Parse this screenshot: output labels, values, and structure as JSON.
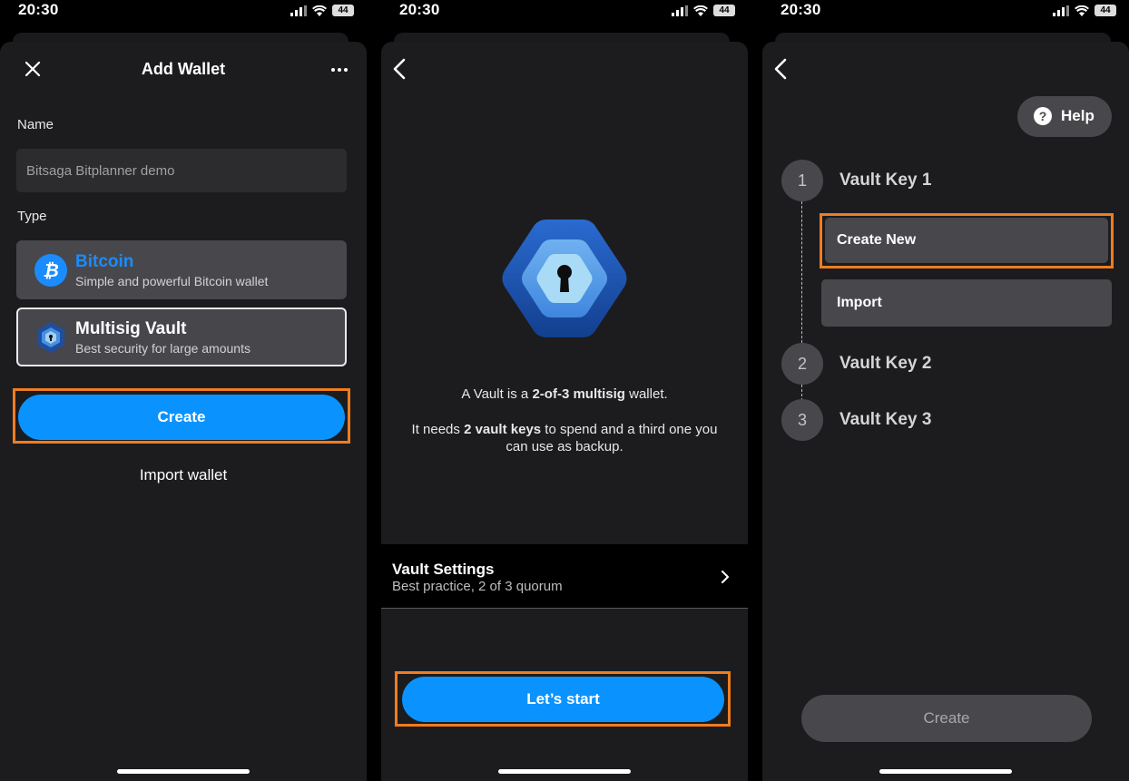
{
  "status": {
    "time": "20:30",
    "battery": "44"
  },
  "screen1": {
    "title": "Add Wallet",
    "name_label": "Name",
    "name_value": "Bitsaga Bitplanner demo",
    "type_label": "Type",
    "bitcoin": {
      "title": "Bitcoin",
      "subtitle": "Simple and powerful Bitcoin wallet"
    },
    "multisig": {
      "title": "Multisig Vault",
      "subtitle": "Best security for large amounts"
    },
    "create_button": "Create",
    "import_link": "Import wallet"
  },
  "screen2": {
    "desc1_pre": "A Vault is a ",
    "desc1_bold": "2-of-3 multisig",
    "desc1_post": " wallet.",
    "desc2_pre": "It needs ",
    "desc2_bold": "2 vault keys",
    "desc2_post": " to spend and a third one you",
    "desc2_line2": "can use as backup.",
    "settings_title": "Vault Settings",
    "settings_subtitle": "Best practice, 2 of 3 quorum",
    "start_button": "Let’s start"
  },
  "screen3": {
    "help_button": "Help",
    "steps": [
      {
        "number": "1",
        "label": "Vault Key 1"
      },
      {
        "number": "2",
        "label": "Vault Key 2"
      },
      {
        "number": "3",
        "label": "Vault Key 3"
      }
    ],
    "create_new": "Create New",
    "import": "Import",
    "create_button": "Create"
  },
  "colors": {
    "accent": "#0a93ff",
    "highlight": "#ee7d22",
    "bitcoin_blue": "#1a8cff"
  }
}
